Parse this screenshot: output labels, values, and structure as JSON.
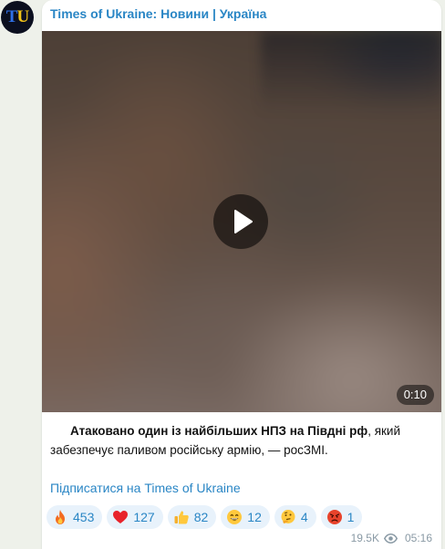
{
  "avatar": {
    "letters": [
      "T",
      "U"
    ]
  },
  "channel": {
    "name": "Times of Ukraine: Новини | Україна"
  },
  "video": {
    "duration": "0:10"
  },
  "message": {
    "bold_text": "Атаковано один із найбільших НПЗ на Півдні рф",
    "rest_text": ", який забезпечує паливом російську армію, — росЗМІ.",
    "subscribe_link": "Підписатися на Times of Ukraine"
  },
  "reactions": [
    {
      "icon": "fire-icon",
      "count": "453"
    },
    {
      "icon": "heart-icon",
      "count": "127"
    },
    {
      "icon": "thumbs-up-icon",
      "count": "82"
    },
    {
      "icon": "grinning-face-icon",
      "count": "12"
    },
    {
      "icon": "thinking-face-icon",
      "count": "4"
    },
    {
      "icon": "angry-face-icon",
      "count": "1"
    }
  ],
  "meta": {
    "views": "19.5K",
    "time": "05:16"
  },
  "colors": {
    "link": "#2a86c5",
    "reaction_bg": "#e8f2fb",
    "chat_bg": "#eef1ea"
  }
}
